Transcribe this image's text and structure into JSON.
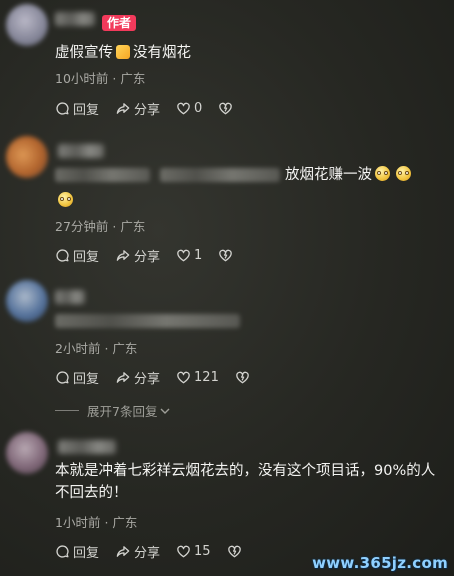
{
  "comments": [
    {
      "author_badge": "作者",
      "text_before": "虚假宣传",
      "text_after": "没有烟花",
      "time": "10小时前",
      "location": "广东",
      "reply_label": "回复",
      "share_label": "分享",
      "likes": "0"
    },
    {
      "text": "放烟花赚一波",
      "time": "27分钟前",
      "location": "广东",
      "reply_label": "回复",
      "share_label": "分享",
      "likes": "1"
    },
    {
      "time": "2小时前",
      "location": "广东",
      "reply_label": "回复",
      "share_label": "分享",
      "likes": "121",
      "expand_label": "展开7条回复"
    },
    {
      "text": "本就是冲着七彩祥云烟花去的，没有这个项目话，90%的人不回去的！",
      "time": "1小时前",
      "location": "广东",
      "reply_label": "回复",
      "share_label": "分享",
      "likes": "15"
    }
  ],
  "separator": "·",
  "watermark": "www.365jz.com",
  "icons": [
    "reply-icon",
    "share-icon",
    "like-icon",
    "dislike-icon",
    "chevron-down-icon",
    "thumbs-up-emoji",
    "smile-emoji"
  ],
  "colors": {
    "author_badge": "#f23a5b",
    "watermark": "#8fd0ff"
  }
}
